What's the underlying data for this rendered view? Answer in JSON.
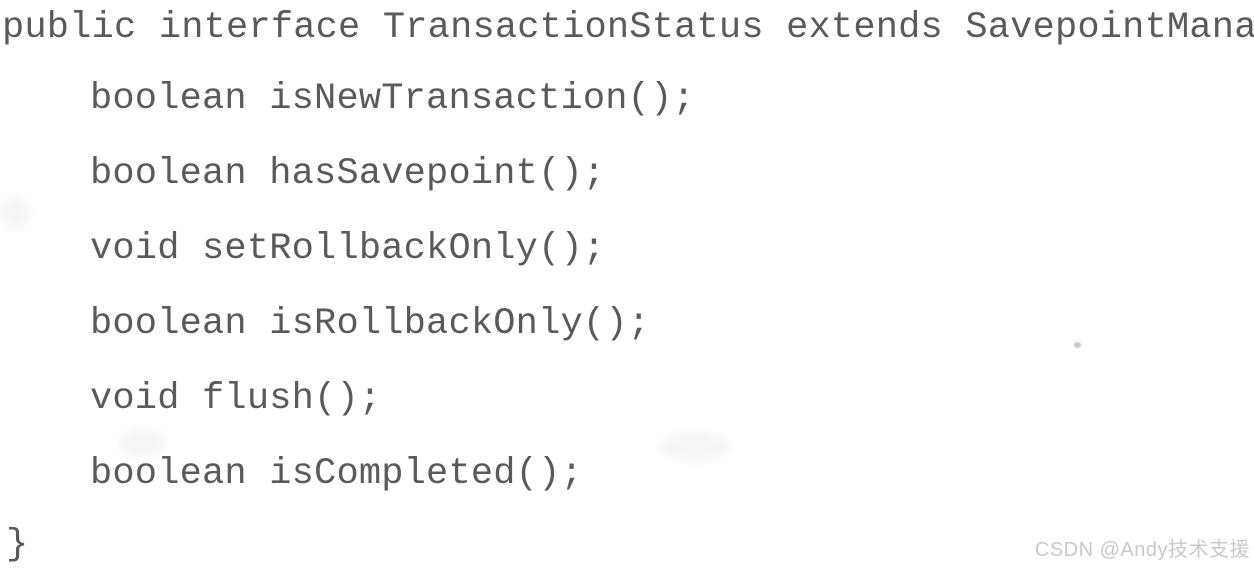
{
  "document": {
    "type": "scanned-code-listing",
    "language": "java",
    "background_color": "#ffffff",
    "text_color": "#4d4d4d",
    "code_lines": [
      "public interface TransactionStatus extends SavepointManager {",
      "boolean isNewTransaction();",
      "boolean hasSavepoint();",
      "void setRollbackOnly();",
      "boolean isRollbackOnly();",
      "void flush();",
      "boolean isCompleted();",
      "}"
    ]
  },
  "watermark": {
    "text": "CSDN @Andy技术支援",
    "color": "#c9c9c9"
  }
}
